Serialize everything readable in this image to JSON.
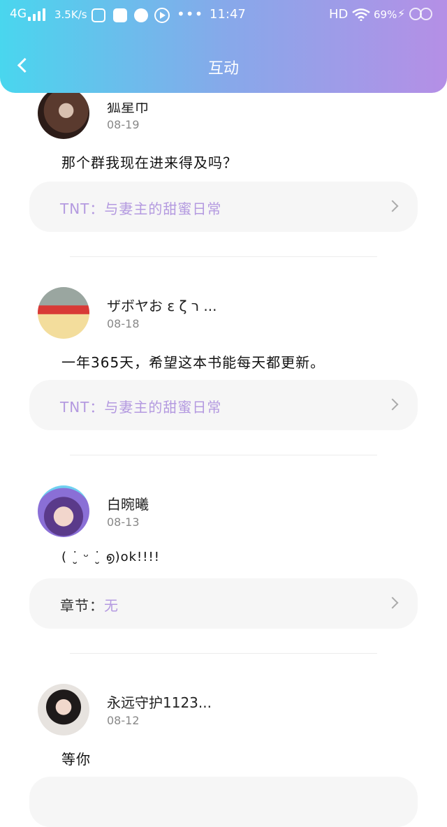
{
  "status": {
    "network": "4G",
    "speed": "3.5K/s",
    "time": "11:47",
    "hd": "HD",
    "battery": "69%"
  },
  "header": {
    "title": "互动"
  },
  "posts": [
    {
      "name": "狐星巾",
      "date": "08-19",
      "content": "那个群我现在进来得及吗？",
      "book_prefix": "TNT：",
      "book_value": "与妻主的甜蜜日常"
    },
    {
      "name": "ザボヤお ε ζ ר ...",
      "date": "08-18",
      "content": "一年365天，希望这本书能每天都更新。",
      "book_prefix": "TNT：",
      "book_value": "与妻主的甜蜜日常"
    },
    {
      "name": "白晼曦",
      "date": "08-13",
      "content": "( ˙̮ ᵕ ˙̮ ൭)ok!!!!",
      "book_prefix": "章节：",
      "book_value": "无"
    },
    {
      "name": "永远守护1123...",
      "date": "08-12",
      "content": "等你"
    }
  ]
}
